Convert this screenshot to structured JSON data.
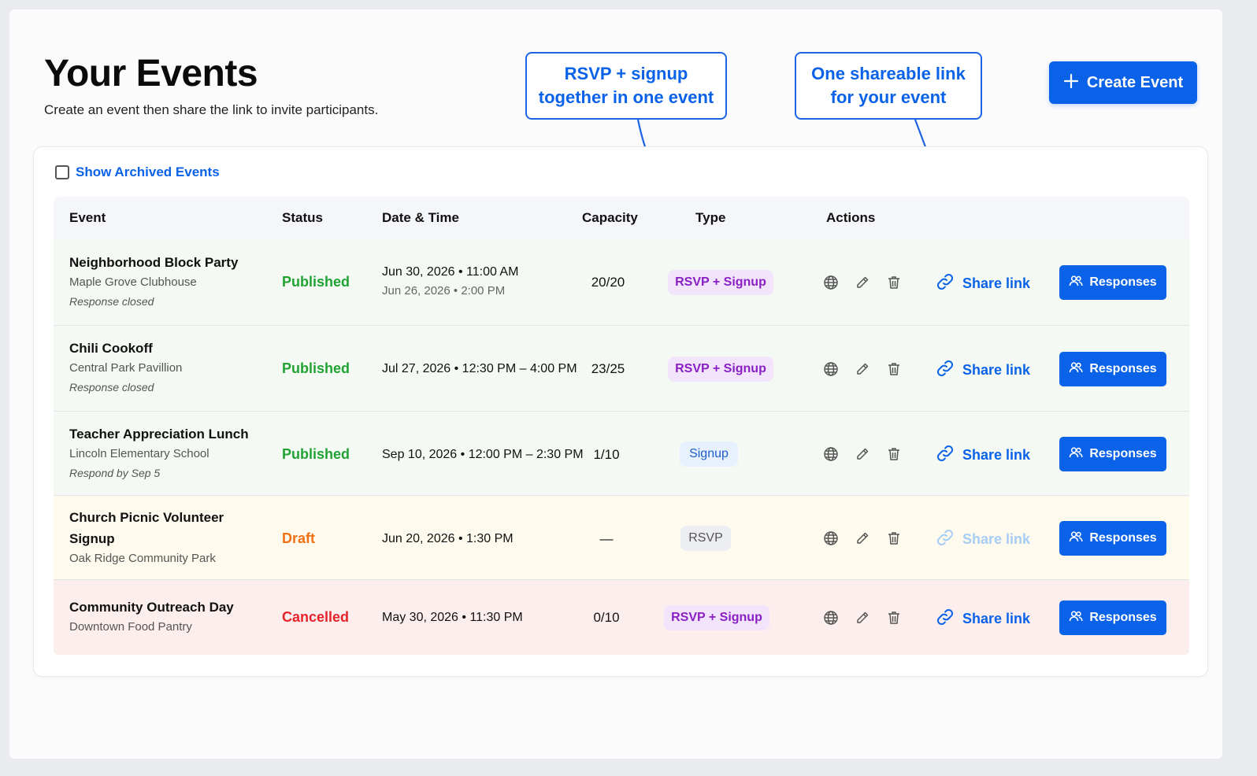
{
  "header": {
    "title": "Your Events",
    "subtitle": "Create an event then share the link to invite participants.",
    "create_button": "Create Event"
  },
  "callouts": [
    "RSVP + signup\ntogether in one event",
    "One shareable link\nfor your event"
  ],
  "filters": {
    "show_archived_label": "Show Archived Events",
    "show_archived_checked": false
  },
  "table": {
    "columns": [
      "Event",
      "Status",
      "Date & Time",
      "Capacity",
      "Type",
      "Actions"
    ],
    "share_label": "Share link",
    "responses_label": "Responses",
    "rows": [
      {
        "name": "Neighborhood Block Party",
        "location": "Maple Grove Clubhouse",
        "note": "Response closed",
        "status": "Published",
        "datetime": "Jun 30, 2026 • 11:00 AM",
        "datetime_sub": "Jun 26, 2026 • 2:00 PM",
        "capacity": "20/20",
        "type": "RSVP + Signup",
        "share_enabled": true
      },
      {
        "name": "Chili Cookoff",
        "location": "Central Park Pavillion",
        "note": "Response closed",
        "status": "Published",
        "datetime": "Jul 27, 2026 • 12:30 PM – 4:00 PM",
        "capacity": "23/25",
        "type": "RSVP + Signup",
        "share_enabled": true
      },
      {
        "name": "Teacher Appreciation Lunch",
        "location": "Lincoln Elementary School",
        "note": "Respond by Sep 5",
        "status": "Published",
        "datetime": "Sep 10, 2026 • 12:00 PM – 2:30 PM",
        "capacity": "1/10",
        "type": "Signup",
        "share_enabled": true
      },
      {
        "name_line1": "Church Picnic Volunteer",
        "name_line2": "Signup",
        "location": "Oak Ridge Community Park",
        "status": "Draft",
        "datetime": "Jun 20, 2026 • 1:30 PM",
        "capacity": "—",
        "type": "RSVP",
        "share_enabled": false
      },
      {
        "name": "Community Outreach Day",
        "location": "Downtown Food Pantry",
        "status": "Cancelled",
        "datetime": "May 30, 2026 • 11:30 PM",
        "capacity": "0/10",
        "type": "RSVP + Signup",
        "share_enabled": true
      }
    ]
  },
  "colors": {
    "accent": "#0a62e8",
    "published": "#21a334",
    "draft": "#f07114",
    "cancelled": "#e5232a",
    "badge_purple": "#8a1fc4"
  },
  "icons": [
    "plus-icon",
    "globe-icon",
    "pencil-icon",
    "trash-icon",
    "link-icon",
    "users-icon"
  ]
}
